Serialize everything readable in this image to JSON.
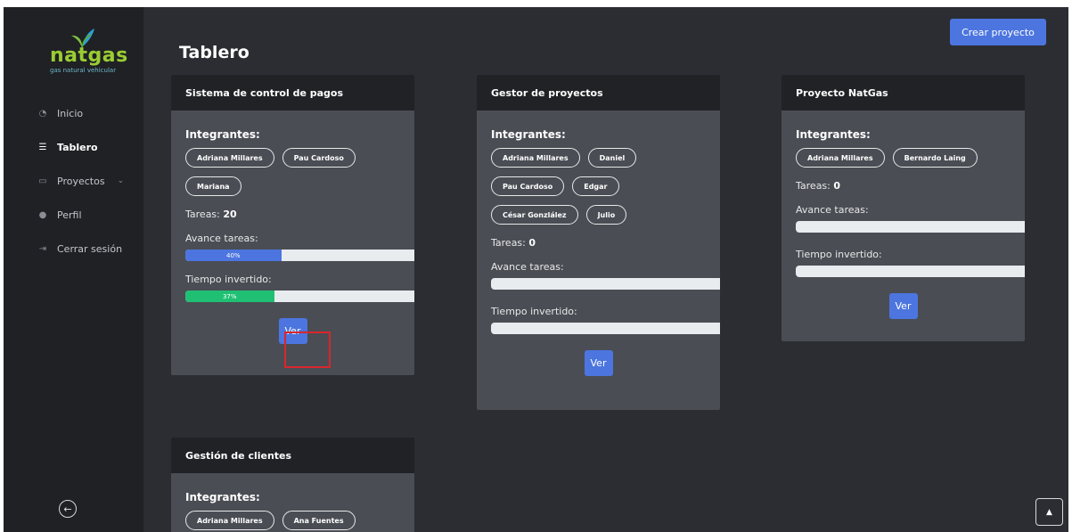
{
  "brand": {
    "name": "natgas",
    "tagline": "gas natural vehicular"
  },
  "sidebar": {
    "items": [
      {
        "label": "Inicio",
        "icon": "dashboard-icon"
      },
      {
        "label": "Tablero",
        "icon": "list-icon",
        "active": true
      },
      {
        "label": "Proyectos",
        "icon": "folder-icon",
        "caret": "chevron-down-icon"
      },
      {
        "label": "Perfil",
        "icon": "user-icon"
      },
      {
        "label": "Cerrar sesión",
        "icon": "logout-icon"
      }
    ],
    "collapse_icon": "arrow-left-circle-icon"
  },
  "header": {
    "title": "Tablero",
    "create_button": "Crear proyecto"
  },
  "labels": {
    "members": "Integrantes:",
    "tasks": "Tareas:",
    "task_progress": "Avance tareas:",
    "time_spent": "Tiempo invertido:",
    "view": "Ver"
  },
  "cards": [
    {
      "title": "Sistema de control de pagos",
      "members": [
        "Adriana Millares",
        "Pau Cardoso",
        "Mariana"
      ],
      "tasks": "20",
      "task_progress": 0.4,
      "task_progress_label": "40%",
      "time_spent": 0.37,
      "time_spent_label": "37%"
    },
    {
      "title": "Gestor de proyectos",
      "members": [
        "Adriana Millares",
        "Daniel",
        "Pau Cardoso",
        "Edgar",
        "César Gonzlález",
        "Julio"
      ],
      "tasks": "0",
      "task_progress": 0,
      "time_spent": 0
    },
    {
      "title": "Proyecto NatGas",
      "members": [
        "Adriana Millares",
        "Bernardo Laing"
      ],
      "tasks": "0",
      "task_progress": 0,
      "time_spent": 0
    },
    {
      "title": "Gestión de clientes",
      "members": [
        "Adriana Millares",
        "Ana Fuentes"
      ]
    }
  ],
  "colors": {
    "accent": "#4c75df",
    "progress_blue": "#4c75df",
    "progress_green": "#20c074",
    "highlight": "#d9262c",
    "brand_green": "#9acd32"
  }
}
